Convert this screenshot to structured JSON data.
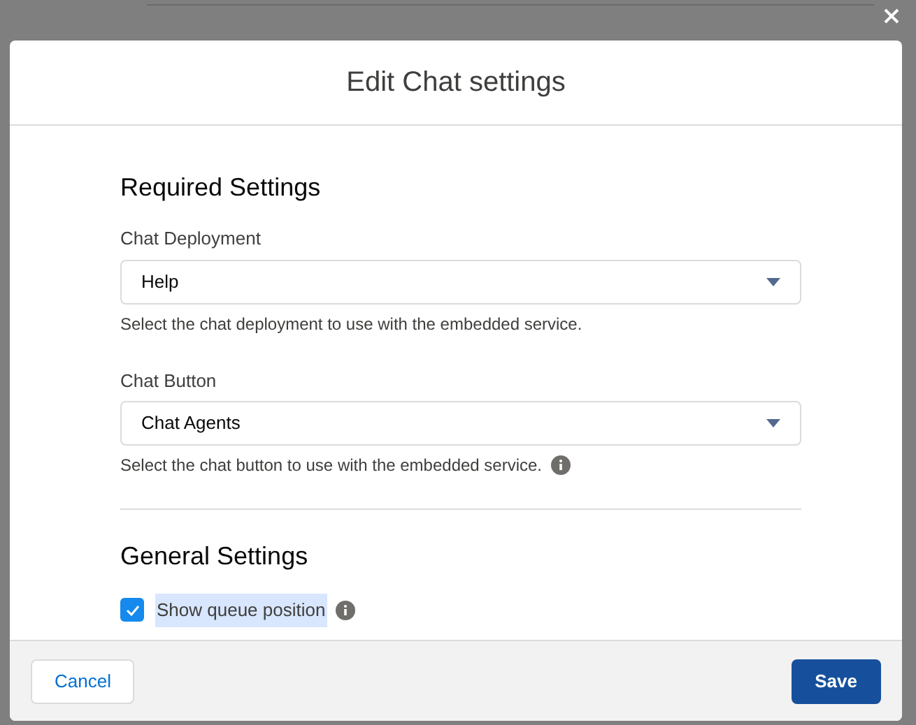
{
  "modal": {
    "title": "Edit Chat settings"
  },
  "sections": [
    {
      "heading": "Required Settings",
      "fields": [
        {
          "kind": "select",
          "label": "Chat Deployment",
          "value": "Help",
          "help": "Select the chat deployment to use with the embedded service.",
          "info": false
        },
        {
          "kind": "select",
          "label": "Chat Button",
          "value": "Chat Agents",
          "help": "Select the chat button to use with the embedded service.",
          "info": true
        }
      ]
    },
    {
      "heading": "General Settings",
      "fields": [
        {
          "kind": "checkbox",
          "label": "Show queue position",
          "checked": true,
          "info": true
        }
      ]
    }
  ],
  "footer": {
    "cancel": "Cancel",
    "save": "Save"
  }
}
